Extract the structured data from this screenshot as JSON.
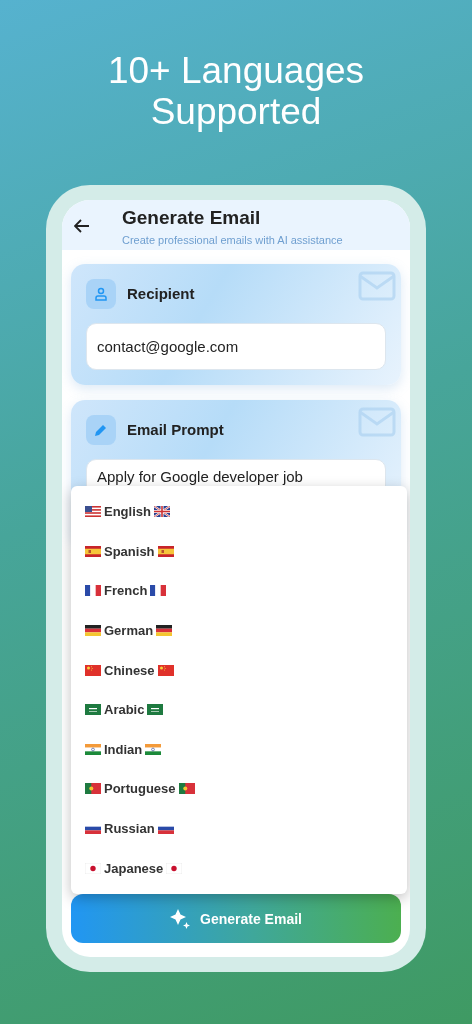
{
  "headline": "10+ Languages Supported",
  "app_bar": {
    "title": "Generate Email",
    "subtitle": "Create professional emails with AI assistance"
  },
  "recipient": {
    "label": "Recipient",
    "value": "contact@google.com"
  },
  "prompt": {
    "label": "Email Prompt",
    "value": "Apply for Google developer job"
  },
  "language_menu": [
    {
      "label": "English",
      "kind": "usgb"
    },
    {
      "label": "Spanish",
      "kind": "es"
    },
    {
      "label": "French",
      "kind": "fr"
    },
    {
      "label": "German",
      "kind": "de"
    },
    {
      "label": "Chinese",
      "kind": "cn"
    },
    {
      "label": "Arabic",
      "kind": "sa"
    },
    {
      "label": "Indian",
      "kind": "in"
    },
    {
      "label": "Portuguese",
      "kind": "pt"
    },
    {
      "label": "Russian",
      "kind": "ru"
    },
    {
      "label": "Japanese",
      "kind": "jp"
    }
  ],
  "generate_button": {
    "label": "Generate Email"
  }
}
